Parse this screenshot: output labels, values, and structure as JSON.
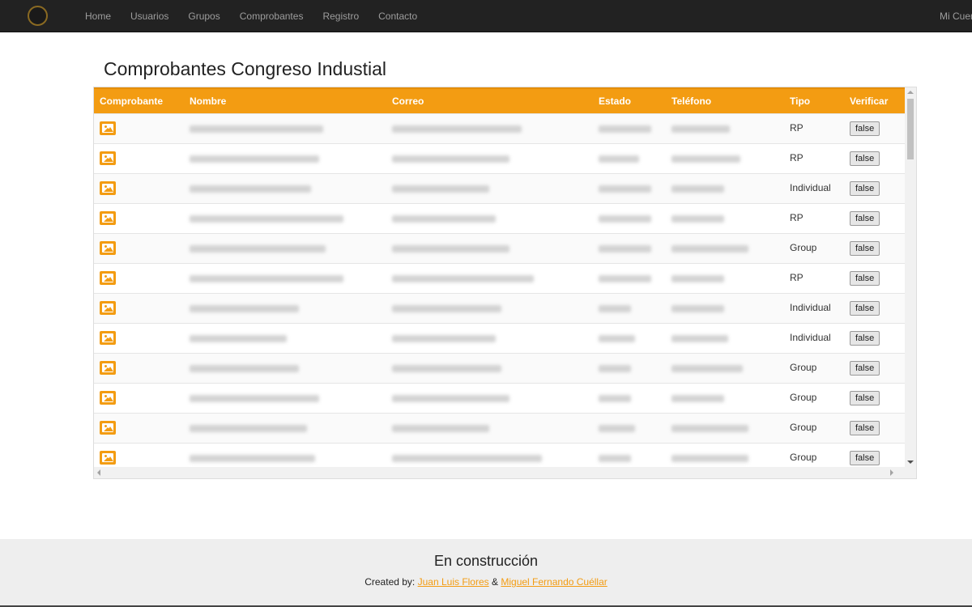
{
  "navbar": {
    "brand_alt": "logo-emblem",
    "links": [
      "Home",
      "Usuarios",
      "Grupos",
      "Comprobantes",
      "Registro",
      "Contacto"
    ],
    "account_label": "Mi Cuenta"
  },
  "page": {
    "title": "Comprobantes Congreso Industial"
  },
  "table": {
    "columns": [
      "Comprobante",
      "Nombre",
      "Correo",
      "Estado",
      "Teléfono",
      "Tipo",
      "Verificar"
    ],
    "rows": [
      {
        "tipo": "RP",
        "verificar": "false"
      },
      {
        "tipo": "RP",
        "verificar": "false"
      },
      {
        "tipo": "Individual",
        "verificar": "false"
      },
      {
        "tipo": "RP",
        "verificar": "false"
      },
      {
        "tipo": "Group",
        "verificar": "false"
      },
      {
        "tipo": "RP",
        "verificar": "false"
      },
      {
        "tipo": "Individual",
        "verificar": "false"
      },
      {
        "tipo": "Individual",
        "verificar": "false"
      },
      {
        "tipo": "Group",
        "verificar": "false"
      },
      {
        "tipo": "Group",
        "verificar": "false"
      },
      {
        "tipo": "Group",
        "verificar": "false"
      },
      {
        "tipo": "Group",
        "verificar": "false"
      }
    ]
  },
  "footer": {
    "title": "En construcción",
    "credit_prefix": "Created by:",
    "author1": "Juan Luis Flores",
    "separator": "&",
    "author2": "Miguel Fernando Cuéllar"
  },
  "colors": {
    "accent": "#f39c12",
    "navbar": "#222222",
    "footer": "#eeeeee"
  },
  "icons": [
    "image-icon",
    "logo-emblem"
  ]
}
